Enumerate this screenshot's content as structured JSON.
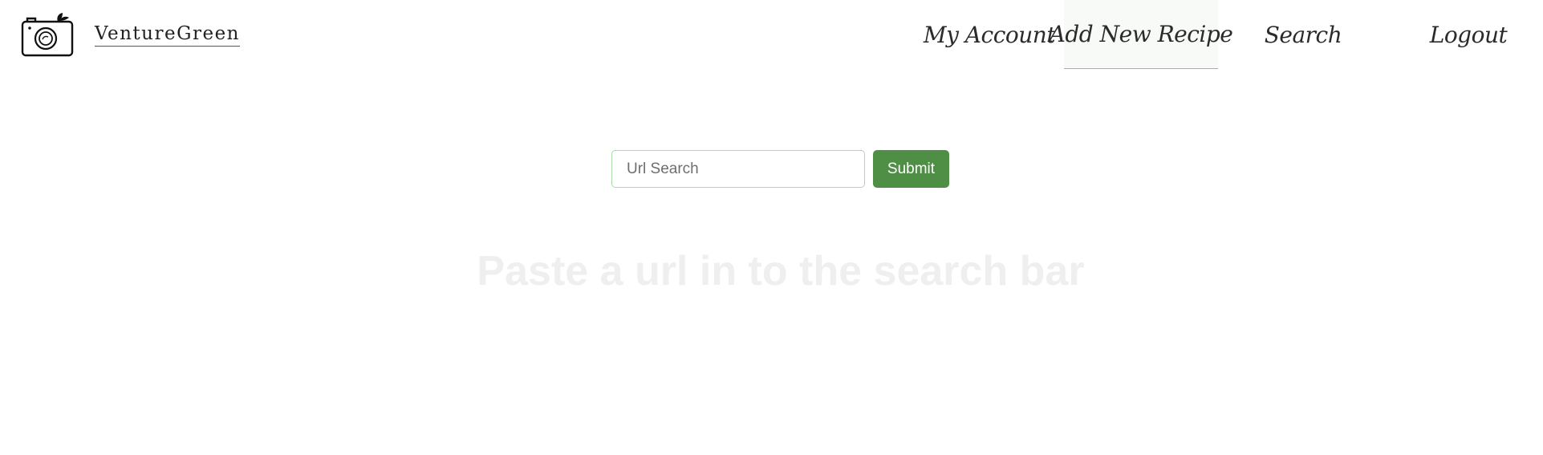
{
  "brand": {
    "name": "VentureGreen",
    "logo_icon": "camera-leaf-icon"
  },
  "nav": {
    "items": [
      {
        "label": "My Account"
      },
      {
        "label": "Add New Recipe",
        "active": true
      },
      {
        "label": "Search"
      },
      {
        "label": "Logout"
      }
    ]
  },
  "search": {
    "placeholder": "Url Search",
    "value": "",
    "submit_label": "Submit"
  },
  "hint": {
    "text": "Paste a url in to the search bar"
  },
  "colors": {
    "accent": "#4f8f45",
    "input_border": "#a9dba9",
    "active_underline": "#8cc58c",
    "hint_text": "#efefef"
  }
}
